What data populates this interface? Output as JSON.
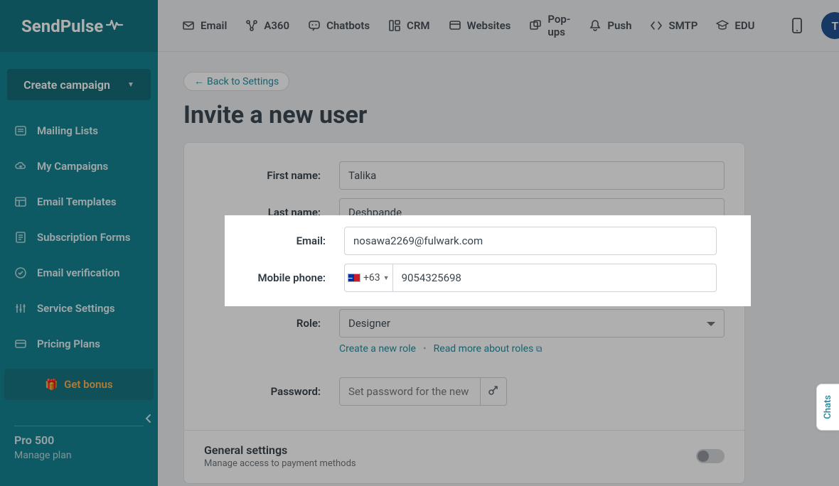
{
  "brand": "SendPulse",
  "create_campaign": "Create campaign",
  "sidebar": {
    "items": [
      {
        "label": "Mailing Lists",
        "icon": "list"
      },
      {
        "label": "My Campaigns",
        "icon": "cloud"
      },
      {
        "label": "Email Templates",
        "icon": "layout"
      },
      {
        "label": "Subscription Forms",
        "icon": "form"
      },
      {
        "label": "Email verification",
        "icon": "check"
      },
      {
        "label": "Service Settings",
        "icon": "sliders"
      },
      {
        "label": "Pricing Plans",
        "icon": "card"
      }
    ],
    "bonus": "Get bonus",
    "plan_name": "Pro 500",
    "manage_plan": "Manage plan"
  },
  "topnav": [
    {
      "label": "Email",
      "icon": "✉"
    },
    {
      "label": "A360",
      "icon": "↯"
    },
    {
      "label": "Chatbots",
      "icon": "◌"
    },
    {
      "label": "CRM",
      "icon": "▥"
    },
    {
      "label": "Websites",
      "icon": "▢"
    },
    {
      "label": "Pop-ups",
      "icon": "◫"
    },
    {
      "label": "Push",
      "icon": "△"
    },
    {
      "label": "SMTP",
      "icon": "</>"
    },
    {
      "label": "EDU",
      "icon": "🎓"
    }
  ],
  "avatar_initial": "T",
  "back_link": "Back to Settings",
  "page_title": "Invite a new user",
  "form": {
    "first_name_label": "First name:",
    "first_name": "Talika",
    "last_name_label": "Last name:",
    "last_name": "Deshpande",
    "email_label": "Email:",
    "email": "nosawa2269@fulwark.com",
    "phone_label": "Mobile phone:",
    "dial_code": "+63",
    "phone": "9054325698",
    "role_label": "Role:",
    "role": "Designer",
    "create_role": "Create a new role",
    "read_roles": "Read more about roles",
    "password_label": "Password:",
    "password_placeholder": "Set password for the new"
  },
  "general": {
    "title": "General settings",
    "subtitle": "Manage access to payment methods"
  },
  "chats_tab": "Chats"
}
